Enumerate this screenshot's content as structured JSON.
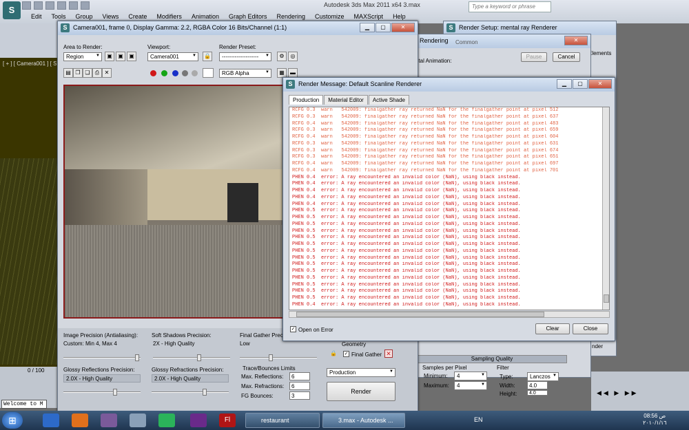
{
  "app": {
    "title": "Autodesk 3ds Max 2011 x64     3.max",
    "search_placeholder": "Type a keyword or phrase",
    "menu": [
      "Edit",
      "Tools",
      "Group",
      "Views",
      "Create",
      "Modifiers",
      "Animation",
      "Graph Editors",
      "Rendering",
      "Customize",
      "MAXScript",
      "Help"
    ],
    "viewport_label": "[ + ] [ Camera001 ] [ Sm",
    "welcome": "Welcome to M",
    "timeline": "0 / 100"
  },
  "frame_window": {
    "title": "Camera001, frame 0, Display Gamma: 2.2, RGBA Color 16 Bits/Channel (1:1)",
    "area_label": "Area to Render:",
    "area_value": "Region",
    "viewport_label": "Viewport:",
    "viewport_value": "Camera001",
    "preset_label": "Render Preset:",
    "preset_value": "--------------------",
    "channel_value": "RGB Alpha",
    "image_precision_label": "Image Precision (Antialiasing):",
    "image_precision_value": "Custom: Min 4, Max 4",
    "soft_shadows_label": "Soft Shadows Precision:",
    "soft_shadows_value": "2X - High Quality",
    "final_gather_label": "Final Gather Precision",
    "final_gather_value": "Low",
    "glossy_refl_label": "Glossy Reflections Precision:",
    "glossy_refl_value": "2.0X - High Quality",
    "glossy_refr_label": "Glossy Refractions Precision:",
    "glossy_refr_value": "2.0X - High Quality",
    "trace_label": "Trace/Bounces Limits",
    "max_refl_label": "Max. Reflections:",
    "max_refl_value": "6",
    "max_refr_label": "Max. Refractions:",
    "max_refr_value": "6",
    "fg_bounces_label": "FG Bounces:",
    "fg_bounces_value": "3",
    "geometry_label": "Geometry",
    "final_gather_check": "Final Gather",
    "production_value": "Production",
    "render_button": "Render"
  },
  "render_setup": {
    "title": "Render Setup: mental ray Renderer",
    "tab_common": "Common",
    "tab_elements": "Elements",
    "render_label": "nder",
    "sampling_title": "Sampling Quality",
    "samples_label": "Samples per Pixel",
    "minimum_label": "Minimum:",
    "minimum_value": "4",
    "maximum_label": "Maximum:",
    "maximum_value": "4",
    "filter_label": "Filter",
    "type_label": "Type:",
    "type_value": "Lanczos",
    "width_label": "Width:",
    "width_value": "4.0",
    "height_label": "Height:",
    "height_value": "4.0"
  },
  "rendering_progress": {
    "title": "Rendering",
    "total_animation": "otal Animation:",
    "pause": "Pause",
    "cancel": "Cancel"
  },
  "render_message": {
    "title": "Render Message: Default Scanline Renderer",
    "tabs": [
      "Production",
      "Material Editor",
      "Active Shade"
    ],
    "lines": [
      {
        "t": "RCFG 0.3  warn   542009: finalgather ray returned NaN for the finalgather point at pixel 512",
        "k": "warn"
      },
      {
        "t": "RCFG 0.3  warn   542009: finalgather ray returned NaN for the finalgather point at pixel 637",
        "k": "warn"
      },
      {
        "t": "RCFG 0.4  warn   542009: finalgather ray returned NaN for the finalgather point at pixel 483",
        "k": "warn"
      },
      {
        "t": "RCFG 0.3  warn   542009: finalgather ray returned NaN for the finalgather point at pixel 659",
        "k": "warn"
      },
      {
        "t": "RCFG 0.4  warn   542009: finalgather ray returned NaN for the finalgather point at pixel 604",
        "k": "warn"
      },
      {
        "t": "RCFG 0.3  warn   542009: finalgather ray returned NaN for the finalgather point at pixel 631",
        "k": "warn"
      },
      {
        "t": "RCFG 0.3  warn   542009: finalgather ray returned NaN for the finalgather point at pixel 674",
        "k": "warn"
      },
      {
        "t": "RCFG 0.3  warn   542009: finalgather ray returned NaN for the finalgather point at pixel 651",
        "k": "warn"
      },
      {
        "t": "RCFG 0.4  warn   542009: finalgather ray returned NaN for the finalgather point at pixel 697",
        "k": "warn"
      },
      {
        "t": "RCFG 0.4  warn   542009: finalgather ray returned NaN for the finalgather point at pixel 701",
        "k": "warn"
      },
      {
        "t": "PHEN 0.4  error: A ray encountered an invalid color (NaN), using black instead.",
        "k": "err"
      },
      {
        "t": "PHEN 0.4  error: A ray encountered an invalid color (NaN), using black instead.",
        "k": "err"
      },
      {
        "t": "PHEN 0.4  error: A ray encountered an invalid color (NaN), using black instead.",
        "k": "err"
      },
      {
        "t": "PHEN 0.4  error: A ray encountered an invalid color (NaN), using black instead.",
        "k": "err"
      },
      {
        "t": "PHEN 0.4  error: A ray encountered an invalid color (NaN), using black instead.",
        "k": "err"
      },
      {
        "t": "PHEN 0.5  error: A ray encountered an invalid color (NaN), using black instead.",
        "k": "err"
      },
      {
        "t": "PHEN 0.5  error: A ray encountered an invalid color (NaN), using black instead.",
        "k": "err"
      },
      {
        "t": "PHEN 0.5  error: A ray encountered an invalid color (NaN), using black instead.",
        "k": "err"
      },
      {
        "t": "PHEN 0.5  error: A ray encountered an invalid color (NaN), using black instead.",
        "k": "err"
      },
      {
        "t": "PHEN 0.5  error: A ray encountered an invalid color (NaN), using black instead.",
        "k": "err"
      },
      {
        "t": "PHEN 0.5  error: A ray encountered an invalid color (NaN), using black instead.",
        "k": "err"
      },
      {
        "t": "PHEN 0.5  error: A ray encountered an invalid color (NaN), using black instead.",
        "k": "err"
      },
      {
        "t": "PHEN 0.5  error: A ray encountered an invalid color (NaN), using black instead.",
        "k": "err"
      },
      {
        "t": "PHEN 0.5  error: A ray encountered an invalid color (NaN), using black instead.",
        "k": "err"
      },
      {
        "t": "PHEN 0.5  error: A ray encountered an invalid color (NaN), using black instead.",
        "k": "err"
      },
      {
        "t": "PHEN 0.5  error: A ray encountered an invalid color (NaN), using black instead.",
        "k": "err"
      },
      {
        "t": "PHEN 0.5  error: A ray encountered an invalid color (NaN), using black instead.",
        "k": "err"
      },
      {
        "t": "PHEN 0.5  error: A ray encountered an invalid color (NaN), using black instead.",
        "k": "err"
      },
      {
        "t": "PHEN 0.5  error: A ray encountered an invalid color (NaN), using black instead.",
        "k": "err"
      },
      {
        "t": "PHEN 0.4  error: A ray encountered an invalid color (NaN), using black instead.",
        "k": "err"
      }
    ],
    "open_on_error": "Open on Error",
    "clear": "Clear",
    "close": "Close",
    "colors": {
      "warn": "#e06040",
      "err": "#d01818"
    }
  },
  "taskbar": {
    "restaurant": "restaurant",
    "max_task": "3.max - Autodesk ...",
    "lang": "EN",
    "time": "08:56 ص",
    "date": "٢٠١٠/١/١٦"
  }
}
